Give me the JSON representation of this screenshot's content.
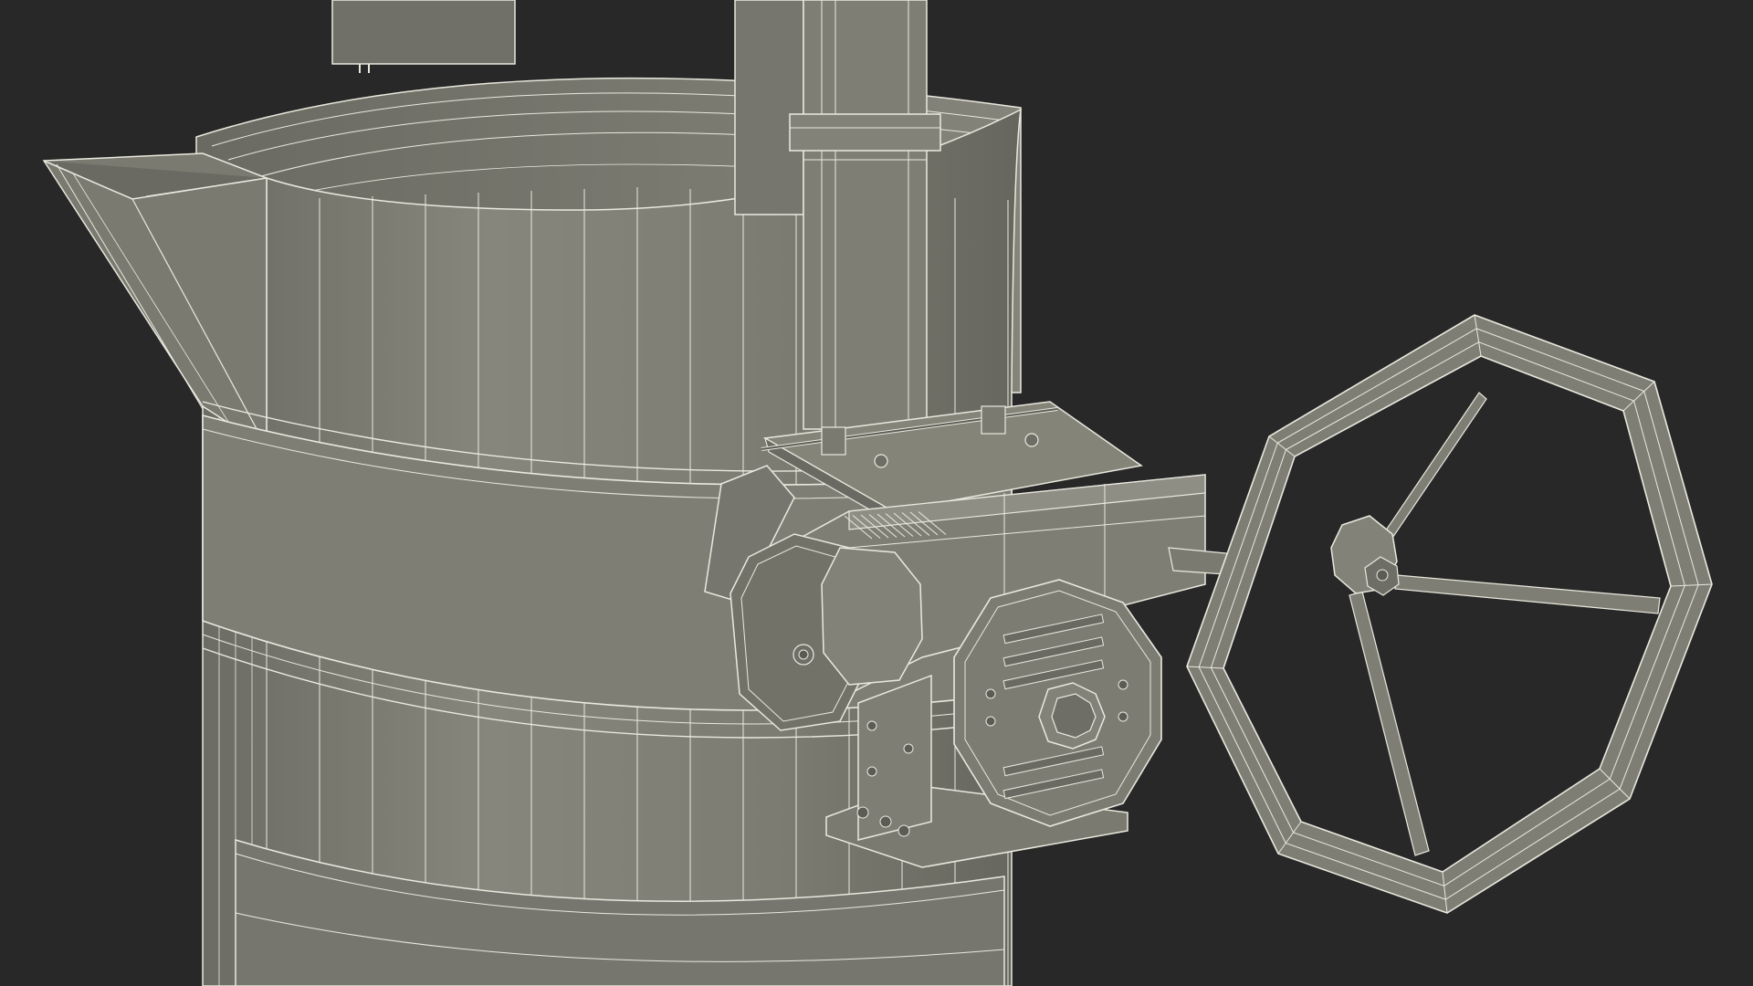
{
  "scene": {
    "background_color": "#282828",
    "model_fill_color": "#7c7c72",
    "model_shade_color": "#6a6a62",
    "model_light_color": "#8e8e84",
    "wire_color": "#e9e9df",
    "edge_color": "#3a3a34",
    "objects": [
      "ladle-bucket",
      "pouring-spout",
      "reinforcement-band-upper",
      "reinforcement-band-lower",
      "lifting-bail-post",
      "tilting-gearbox",
      "gear-cover-plate",
      "handwheel"
    ]
  }
}
